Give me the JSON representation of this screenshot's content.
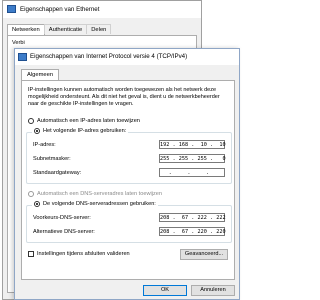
{
  "background_window": {
    "title": "Eigenschappen van Ethernet",
    "tabs": [
      "Netwerken",
      "Authenticatie",
      "Delen"
    ],
    "partial_text": "Verbi"
  },
  "dialog": {
    "title": "Eigenschappen van Internet Protocol versie 4 (TCP/IPv4)",
    "tab": "Algemeen",
    "intro": "IP-instellingen kunnen automatisch worden toegewezen als het netwerk deze mogelijkheid ondersteunt. Als dit niet het geval is, dient u de netwerkbeheerder naar de geschikte IP-instellingen te vragen.",
    "ip_auto_label": "Automatisch een IP-adres laten toewijzen",
    "ip_manual_label": "Het volgende IP-adres gebruiken:",
    "ip_address_label": "IP-adres:",
    "ip_address_value": "192 . 168 .  10 .  10",
    "subnet_label": "Subnetmasker:",
    "subnet_value": "255 . 255 . 255 .   0",
    "gateway_label": "Standaardgateway:",
    "gateway_value": " .     .     .   ",
    "dns_auto_label": "Automatisch een DNS-serveradres laten toewijzen",
    "dns_manual_label": "De volgende DNS-serveradressen gebruiken:",
    "dns_preferred_label": "Voorkeurs-DNS-server:",
    "dns_preferred_value": "208 .  67 . 222 . 222",
    "dns_alternate_label": "Alternatieve DNS-server:",
    "dns_alternate_value": "208 .  67 . 220 . 220",
    "validate_label": "Instellingen tijdens afsluiten valideren",
    "advanced_button": "Geavanceerd...",
    "ok_button": "OK",
    "cancel_button": "Annuleren"
  },
  "colors": {
    "window_bg": "#f0f0f0",
    "ok_border": "#0078d7",
    "disabled_text": "#8a8a8a"
  }
}
